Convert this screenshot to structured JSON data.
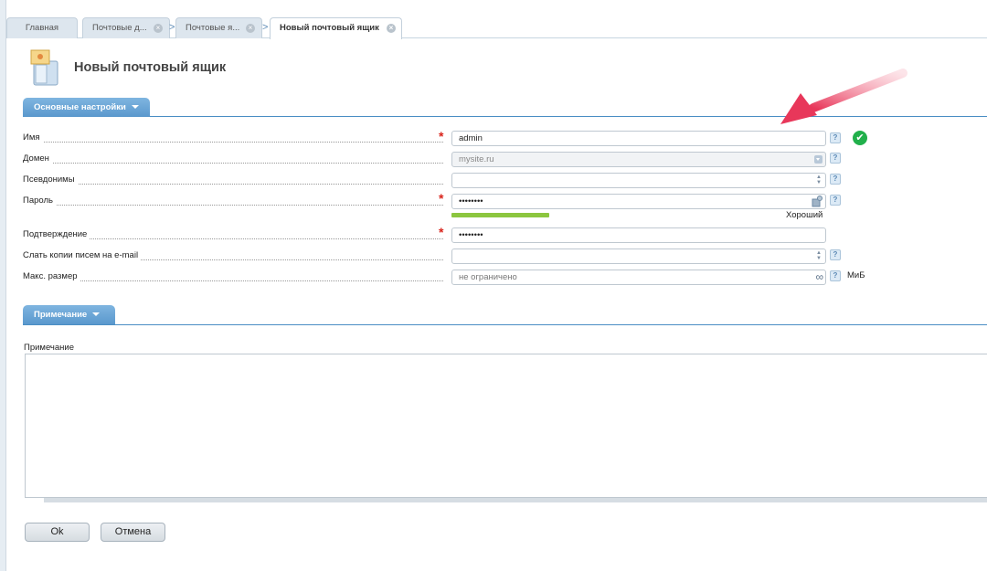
{
  "tabs": [
    {
      "label": "Главная"
    },
    {
      "label": "Почтовые д..."
    },
    {
      "label": "Почтовые я..."
    },
    {
      "label": "Новый почтовый ящик"
    }
  ],
  "page_title": "Новый почтовый ящик",
  "sections": {
    "main_label": "Основные настройки",
    "note_label": "Примечание"
  },
  "form": {
    "name": {
      "label": "Имя",
      "value": "admin",
      "required": true
    },
    "domain": {
      "label": "Домен",
      "value": "mysite.ru"
    },
    "aliases": {
      "label": "Псевдонимы",
      "value": ""
    },
    "password": {
      "label": "Пароль",
      "value": "••••••••",
      "required": true,
      "strength_label": "Хороший",
      "strength_level": 0.26
    },
    "confirm": {
      "label": "Подтверждение",
      "value": "••••••••",
      "required": true
    },
    "copies": {
      "label": "Слать копии писем на e-mail",
      "value": ""
    },
    "max_size": {
      "label": "Макс. размер",
      "placeholder": "не ограничено",
      "unit": "МиБ"
    }
  },
  "note": {
    "label": "Примечание",
    "value": ""
  },
  "buttons": {
    "ok": "Ok",
    "cancel": "Отмена"
  },
  "icons": {
    "help": "?",
    "required_mark": "*",
    "valid": "✔",
    "infinity": "∞"
  },
  "colors": {
    "accent": "#5a98cd",
    "required": "#d9241b",
    "valid": "#21b04b",
    "strength": "#8cc63f",
    "arrow": "#e8375a"
  }
}
